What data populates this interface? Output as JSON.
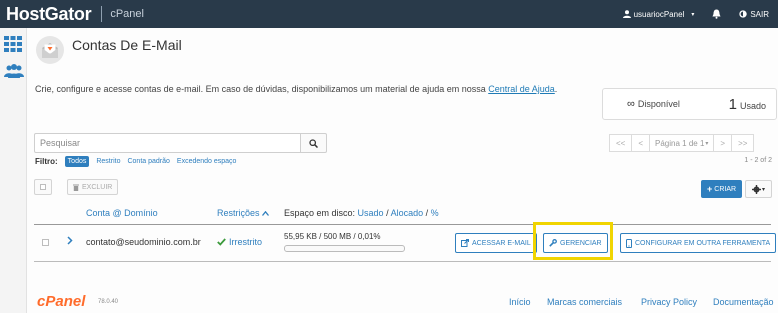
{
  "header": {
    "brand": "HostGator",
    "product": "cPanel",
    "user": "usuariocPanel",
    "logout_label": "SAIR"
  },
  "page": {
    "title": "Contas De E-Mail",
    "intro_text": "Crie, configure e acesse contas de e-mail. Em caso de dúvidas, disponibilizamos um material de ajuda em nossa ",
    "intro_link": "Central de Ajuda",
    "intro_end": "."
  },
  "stats": {
    "available_value": "∞",
    "available_label": "Disponível",
    "used_value": "1",
    "used_label": "Usado"
  },
  "search": {
    "placeholder": "Pesquisar"
  },
  "pagination": {
    "first": "<<",
    "prev": "<",
    "page_label": "Página 1 de 1",
    "next": ">",
    "last": ">>",
    "count": "1 - 2 of 2"
  },
  "filter": {
    "label": "Filtro:",
    "options": [
      "Todos",
      "Restrito",
      "Conta padrão",
      "Excedendo espaço"
    ]
  },
  "toolbar": {
    "delete_label": "EXCLUIR",
    "create_label": "CRIAR"
  },
  "table": {
    "col_account": "Conta @ Domínio",
    "col_restrictions": "Restrições",
    "col_disk_prefix": "Espaço em disco: ",
    "col_disk_used": "Usado",
    "col_disk_sep1": " / ",
    "col_disk_alloc": "Alocado",
    "col_disk_sep2": " / ",
    "col_disk_pct": "%",
    "rows": [
      {
        "email": "contato@seudominio.com.br",
        "status": "Irrestrito",
        "usage": "55,95 KB / 500 MB / 0,01%",
        "usage_fraction": 0.0001,
        "btn_access": "ACESSAR E-MAIL",
        "btn_manage": "GERENCIAR",
        "btn_config": "CONFIGURAR EM OUTRA FERRAMENTA"
      }
    ]
  },
  "footer": {
    "logo": "cPanel",
    "version": "78.0.40",
    "links": [
      "Início",
      "Marcas comerciais",
      "Privacy Policy",
      "Documentação"
    ]
  },
  "colors": {
    "topbar": "#293a4a",
    "accent": "#2f7fbe",
    "highlight": "#f0d400",
    "cpanel_orange": "#ff6c2c"
  }
}
